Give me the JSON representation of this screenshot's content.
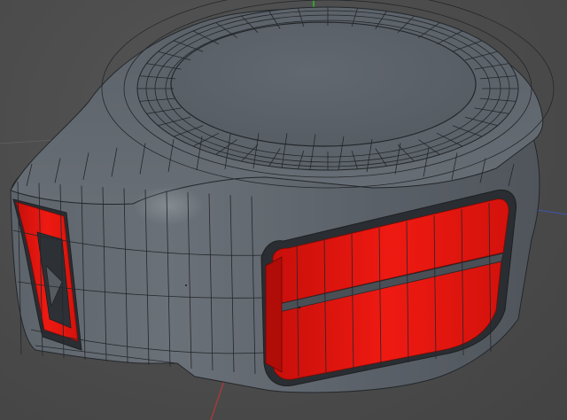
{
  "scene": {
    "model": "tape-measure-shell",
    "mesh_color": "#5a6168",
    "accent_color": "#e4150f",
    "wire_color": "#23272b",
    "background_color": "#4a4a4a",
    "axis_colors": {
      "x": "#4a5fb8",
      "y": "#2bd12b",
      "z": "#c23a3a"
    },
    "display_mode": "shaded-with-wireframe"
  }
}
